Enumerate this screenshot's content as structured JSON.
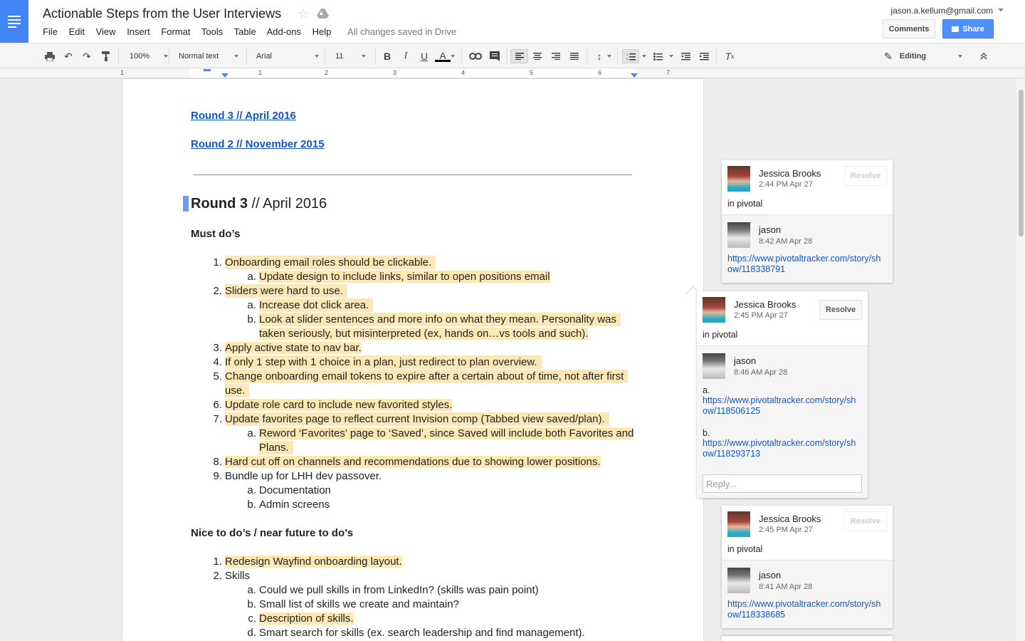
{
  "app": {
    "title": "Actionable Steps from the User Interviews",
    "saved_status": "All changes saved in Drive",
    "account": "jason.a.kellum@gmail.com",
    "comments_label": "Comments",
    "share_label": "Share"
  },
  "menu": [
    "File",
    "Edit",
    "View",
    "Insert",
    "Format",
    "Tools",
    "Table",
    "Add-ons",
    "Help"
  ],
  "toolbar": {
    "zoom": "100%",
    "style": "Normal text",
    "font": "Arial",
    "size": "11",
    "mode": "Editing"
  },
  "ruler": [
    "1",
    "1",
    "2",
    "3",
    "4",
    "5",
    "6",
    "7"
  ],
  "doc": {
    "link1": "Round 3 // April 2016",
    "link2": "Round 2 // November 2015",
    "heading_bold": "Round 3",
    "heading_rest": " // April 2016",
    "must_dos": "Must do’s",
    "nice_to": "Nice to do’s / near future to do’s",
    "items": [
      {
        "n": "1.",
        "t": "Onboarding email roles should be clickable."
      },
      {
        "n": "a.",
        "t": "Update design to include links, similar to open positions email"
      },
      {
        "n": "2.",
        "t": "Sliders were hard to use."
      },
      {
        "n": "a.",
        "t": "Increase dot click area."
      },
      {
        "n": "b.",
        "t": "Look at slider sentences and more info on what they mean. Personality was"
      },
      {
        "n": "",
        "t": "taken seriously, but misinterpreted (ex, hands on…vs tools and such)."
      },
      {
        "n": "3.",
        "t": "Apply active state to nav bar."
      },
      {
        "n": "4.",
        "t": "If only 1 step with 1 choice in a plan, just redirect to plan overview."
      },
      {
        "n": "5.",
        "t": "Change onboarding email tokens to expire after a certain about of time, not after first"
      },
      {
        "n": "",
        "t": "use."
      },
      {
        "n": "6.",
        "t": "Update role card to include new favorited styles."
      },
      {
        "n": "7.",
        "t": "Update favorites page to reflect current Invision comp (Tabbed view saved/plan)."
      },
      {
        "n": "a.",
        "t": "Reword ‘Favorites’ page to ‘Saved’, since Saved will include both Favorites and"
      },
      {
        "n": "",
        "t": "Plans."
      },
      {
        "n": "8.",
        "t": "Hard cut off on channels and recommendations due to showing lower positions."
      },
      {
        "n": "9.",
        "t": "Bundle up for LHH dev passover."
      },
      {
        "n": "a.",
        "t": "Documentation"
      },
      {
        "n": "b.",
        "t": "Admin screens"
      }
    ],
    "items2": [
      {
        "n": "1.",
        "t": "Redesign Wayfind onboarding layout."
      },
      {
        "n": "2.",
        "t": "Skills"
      },
      {
        "n": "a.",
        "t": "Could we pull skills in from LinkedIn? (skills was pain point)"
      },
      {
        "n": "b.",
        "t": "Small list of skills we create and maintain?"
      },
      {
        "n": "c.",
        "t": "Description of skills."
      },
      {
        "n": "d.",
        "t": "Smart search for skills (ex. search leadership and find management)."
      }
    ]
  },
  "comments": [
    {
      "author": "Jessica Brooks",
      "time": "2:44 PM Apr 27",
      "text": "in pivotal",
      "resolve": "Resolve",
      "reply_author": "jason",
      "reply_time": "8:42 AM Apr 28",
      "reply_link_1": "https://www.pivotaltracker.com/story/sh",
      "reply_link_2": "ow/118338791"
    },
    {
      "author": "Jessica Brooks",
      "time": "2:45 PM Apr 27",
      "text": "in pivotal",
      "resolve": "Resolve",
      "reply_author": "jason",
      "reply_time": "8:46 AM Apr 28",
      "a_label": "a.",
      "a_link_1": "https://www.pivotaltracker.com/story/sh",
      "a_link_2": "ow/118506125",
      "b_label": "b.",
      "b_link_1": "https://www.pivotaltracker.com/story/sh",
      "b_link_2": "ow/118293713",
      "reply_placeholder": "Reply..."
    },
    {
      "author": "Jessica Brooks",
      "time": "2:45 PM Apr 27",
      "text": "in pivotal",
      "resolve": "Resolve",
      "reply_author": "jason",
      "reply_time": "8:41 AM Apr 28",
      "reply_link_1": "https://www.pivotaltracker.com/story/sh",
      "reply_link_2": "ow/118338685"
    }
  ],
  "colors": {
    "brand": "#4285f4",
    "highlight": "#fce8b2",
    "link": "#1155cc"
  }
}
